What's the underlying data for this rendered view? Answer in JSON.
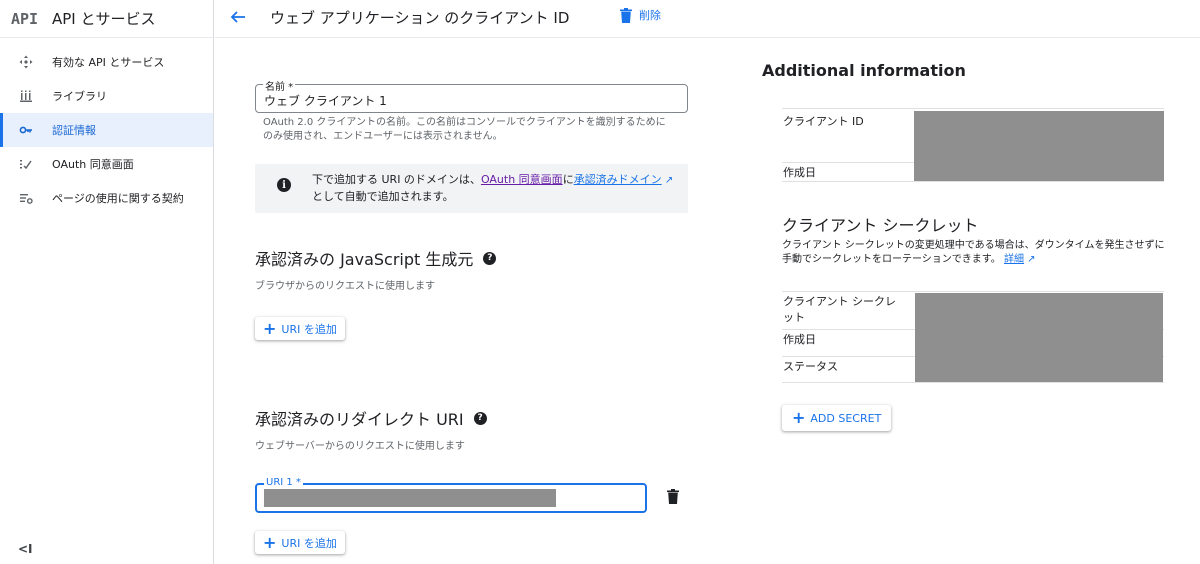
{
  "sidebar": {
    "logo": "API",
    "title": "API とサービス",
    "items": [
      {
        "label": "有効な API とサービス",
        "icon": "diamond-arrows-icon",
        "active": false
      },
      {
        "label": "ライブラリ",
        "icon": "library-icon",
        "active": false
      },
      {
        "label": "認証情報",
        "icon": "key-icon",
        "active": true
      },
      {
        "label": "OAuth 同意画面",
        "icon": "consent-icon",
        "active": false
      },
      {
        "label": "ページの使用に関する契約",
        "icon": "settings-list-icon",
        "active": false
      }
    ],
    "collapse_label": "<I"
  },
  "topbar": {
    "title": "ウェブ アプリケーション のクライアント ID",
    "delete_label": "削除"
  },
  "form": {
    "name_label": "名前 *",
    "name_value": "ウェブ クライアント 1",
    "name_hint_line1": "OAuth 2.0 クライアントの名前。この名前はコンソールでクライアントを識別するために",
    "name_hint_line2": "のみ使用され、エンドユーザーには表示されません。",
    "info_text_1": "下で追加する URI のドメインは、",
    "info_link_consent": "OAuth 同意画面",
    "info_text_2": "に",
    "info_link_domains": "承認済みドメイン",
    "info_text_3": "として自動で追加されます。",
    "js_origins_title": "承認済みの JavaScript 生成元",
    "js_origins_hint": "ブラウザからのリクエストに使用します",
    "add_uri_label": "URI を追加",
    "redirect_title": "承認済みのリダイレクト URI",
    "redirect_hint": "ウェブサーバーからのリクエストに使用します",
    "uri1_label": "URI 1 *"
  },
  "right": {
    "title": "Additional information",
    "client_id_key": "クライアント ID",
    "created_key": "作成日",
    "secret_title": "クライアント シークレット",
    "secret_desc": "クライアント シークレットの変更処理中である場合は、ダウンタイムを発生させずに手動でシークレットをローテーションできます。",
    "details_link": "詳細",
    "secret_key_line1": "クライアント シークレ",
    "secret_key_line2": "ット",
    "secret_created_key": "作成日",
    "status_key": "ステータス",
    "add_secret_label": "ADD SECRET"
  },
  "colors": {
    "accent": "#1a73e8",
    "active_bg": "#e8f0fe",
    "redaction": "#8f8f8f",
    "visited_link": "#681da8"
  }
}
